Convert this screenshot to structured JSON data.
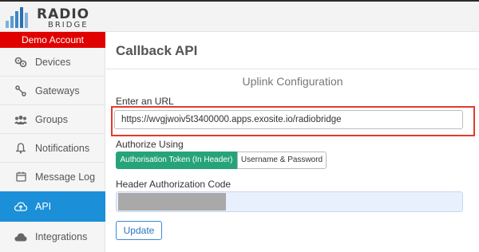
{
  "header": {
    "logo_line1": "RADIO",
    "logo_line2": "BRIDGE"
  },
  "sidebar": {
    "account_label": "Demo Account",
    "items": [
      {
        "label": "Devices",
        "icon": "devices-icon"
      },
      {
        "label": "Gateways",
        "icon": "gateways-icon"
      },
      {
        "label": "Groups",
        "icon": "groups-icon"
      },
      {
        "label": "Notifications",
        "icon": "bell-icon"
      },
      {
        "label": "Message Log",
        "icon": "message-log-icon"
      },
      {
        "label": "API",
        "icon": "cloud-upload-icon",
        "active": true
      },
      {
        "label": "Integrations",
        "icon": "cloud-icon"
      }
    ]
  },
  "main": {
    "title": "Callback API",
    "section_title": "Uplink Configuration",
    "url_label": "Enter an URL",
    "url_value": "https://wvgjwoiv5t3400000.apps.exosite.io/radiobridge",
    "auth_label": "Authorize Using",
    "auth_options": [
      "Authorisation Token (In Header)",
      "Username & Password"
    ],
    "auth_selected": "Authorisation Token (In Header)",
    "header_code_label": "Header Authorization Code",
    "update_label": "Update"
  },
  "colors": {
    "accent_blue": "#1b8fd8",
    "alert_red": "#e00000",
    "highlight_red": "#e23b2b",
    "toggle_green": "#27a37a"
  }
}
